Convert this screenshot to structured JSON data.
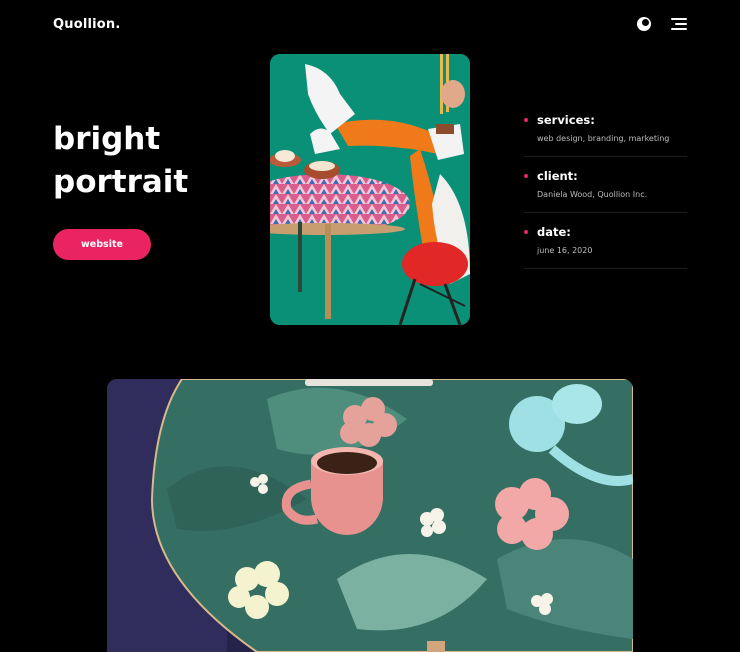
{
  "header": {
    "logo": "Quollion.",
    "theme_icon": "moon-icon",
    "menu_icon": "hamburger-menu-icon"
  },
  "hero": {
    "title_line1": "bright",
    "title_line2": "portrait",
    "button_label": "website"
  },
  "meta": [
    {
      "label": "services:",
      "value": "web design, branding, marketing"
    },
    {
      "label": "client:",
      "value": "Daniela Wood, Quollion Inc."
    },
    {
      "label": "date:",
      "value": "june 16, 2020"
    }
  ],
  "colors": {
    "background": "#000000",
    "accent": "#ea2463",
    "text": "#ffffff",
    "muted": "#bdbdbd"
  }
}
